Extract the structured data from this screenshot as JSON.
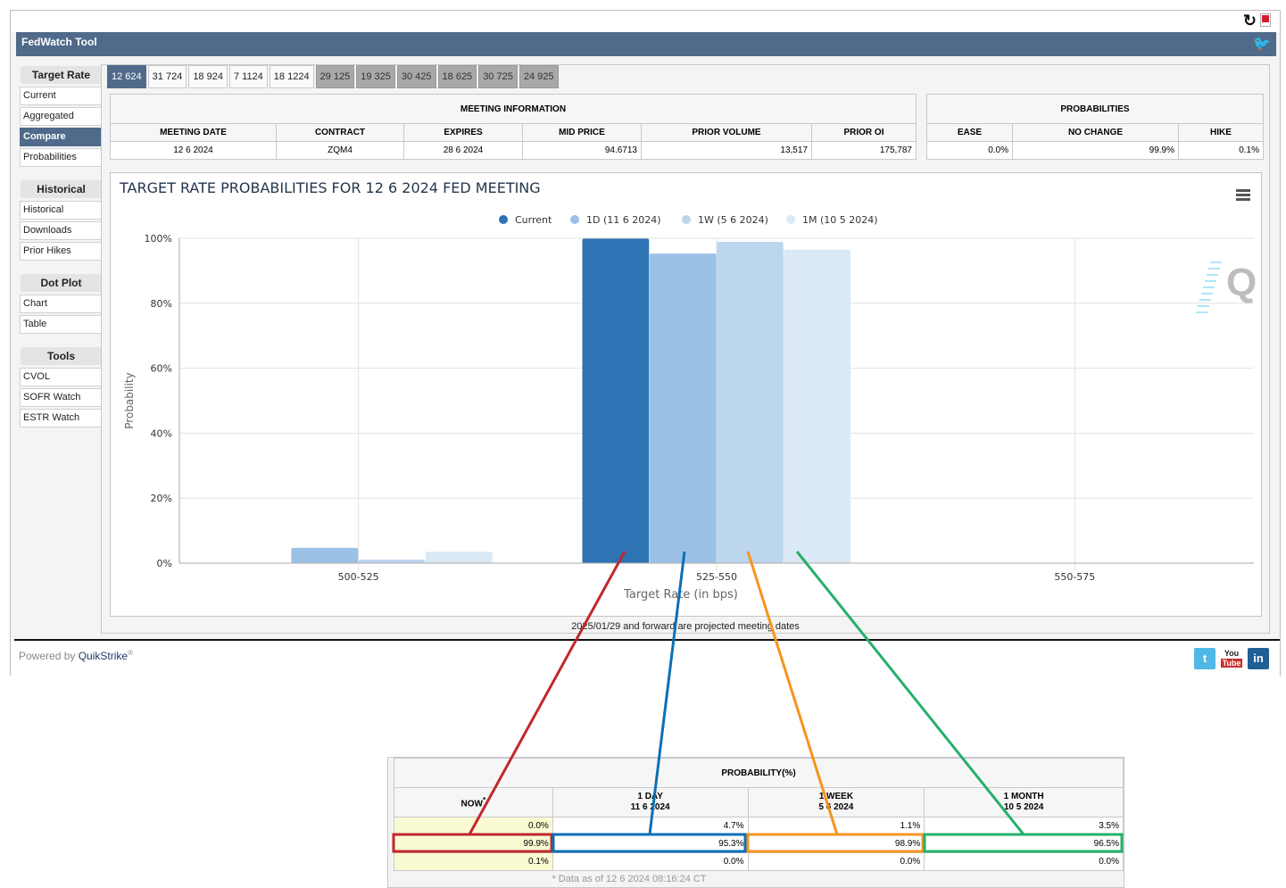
{
  "app": {
    "title": "FedWatch Tool",
    "toolbar_icons": [
      "refresh-icon",
      "pdf-icon"
    ],
    "header_icon": "twitter-icon"
  },
  "sidebar": {
    "sections": [
      {
        "heading": "Target Rate",
        "items": [
          {
            "label": "Current",
            "active": false
          },
          {
            "label": "Aggregated",
            "active": false
          },
          {
            "label": "Compare",
            "active": true
          },
          {
            "label": "Probabilities",
            "active": false
          }
        ]
      },
      {
        "heading": "Historical",
        "items": [
          {
            "label": "Historical",
            "active": false
          },
          {
            "label": "Downloads",
            "active": false
          },
          {
            "label": "Prior Hikes",
            "active": false
          }
        ]
      },
      {
        "heading": "Dot Plot",
        "items": [
          {
            "label": "Chart",
            "active": false
          },
          {
            "label": "Table",
            "active": false
          }
        ]
      },
      {
        "heading": "Tools",
        "items": [
          {
            "label": "CVOL",
            "active": false
          },
          {
            "label": "SOFR Watch",
            "active": false
          },
          {
            "label": "ESTR Watch",
            "active": false
          }
        ]
      }
    ]
  },
  "meeting_tabs": [
    {
      "label": "12 624",
      "state": "active"
    },
    {
      "label": "31 724",
      "state": "normal"
    },
    {
      "label": "18 924",
      "state": "normal"
    },
    {
      "label": "7 1124",
      "state": "normal"
    },
    {
      "label": "18 1224",
      "state": "normal"
    },
    {
      "label": "29 125",
      "state": "future"
    },
    {
      "label": "19 325",
      "state": "future"
    },
    {
      "label": "30 425",
      "state": "future"
    },
    {
      "label": "18 625",
      "state": "future"
    },
    {
      "label": "30 725",
      "state": "future"
    },
    {
      "label": "24 925",
      "state": "future"
    }
  ],
  "meeting_info": {
    "caption": "MEETING INFORMATION",
    "headers": [
      "MEETING DATE",
      "CONTRACT",
      "EXPIRES",
      "MID PRICE",
      "PRIOR VOLUME",
      "PRIOR OI"
    ],
    "values": [
      "12 6 2024",
      "ZQM4",
      "28 6 2024",
      "94.6713",
      "13,517",
      "175,787"
    ]
  },
  "probabilities": {
    "caption": "PROBABILITIES",
    "headers": [
      "EASE",
      "NO CHANGE",
      "HIKE"
    ],
    "values": [
      "0.0%",
      "99.9%",
      "0.1%"
    ]
  },
  "chart_data": {
    "type": "bar",
    "title": "TARGET RATE PROBABILITIES FOR 12 6 2024 FED MEETING",
    "xlabel": "Target Rate (in bps)",
    "ylabel": "Probability",
    "categories": [
      "500-525",
      "525-550",
      "550-575"
    ],
    "ylim": [
      0,
      100
    ],
    "yticks": [
      "0%",
      "20%",
      "40%",
      "60%",
      "80%",
      "100%"
    ],
    "grid": true,
    "legend_position": "top-center",
    "series": [
      {
        "name": "Current",
        "color": "#2e73b3",
        "values": [
          0.0,
          99.9,
          0.0
        ]
      },
      {
        "name": "1D (11 6 2024)",
        "color": "#9bc0e6",
        "values": [
          4.7,
          95.3,
          0.0
        ]
      },
      {
        "name": "1W (5 6 2024)",
        "color": "#bcd6ee",
        "values": [
          1.1,
          98.9,
          0.0
        ]
      },
      {
        "name": "1M (10 5 2024)",
        "color": "#dbe8f5",
        "values": [
          3.5,
          96.5,
          0.0
        ]
      }
    ]
  },
  "note": "2025/01/29 and forward are projected meeting dates",
  "footer": {
    "powered_prefix": "Powered by ",
    "powered_brand": "QuikStrike",
    "registered": "®",
    "social": [
      "twitter-icon",
      "youtube-icon",
      "linkedin-icon"
    ],
    "youtube_top": "You",
    "youtube_bottom": "Tube",
    "linkedin_label": "in"
  },
  "prob_table": {
    "caption": "PROBABILITY(%)",
    "columns": [
      {
        "label": "NOW",
        "sub": "",
        "marker": "*"
      },
      {
        "label": "1 DAY",
        "sub": "11 6 2024"
      },
      {
        "label": "1 WEEK",
        "sub": "5 6 2024"
      },
      {
        "label": "1 MONTH",
        "sub": "10 5 2024"
      }
    ],
    "rows": [
      [
        "0.0%",
        "4.7%",
        "1.1%",
        "3.5%"
      ],
      [
        "99.9%",
        "95.3%",
        "98.9%",
        "96.5%"
      ],
      [
        "0.1%",
        "0.0%",
        "0.0%",
        "0.0%"
      ]
    ],
    "footnote": "* Data as of 12 6 2024 08:16:24 CT",
    "highlight_colors": [
      "#c1272d",
      "#0b6fb8",
      "#f7941d",
      "#23b06b"
    ]
  }
}
